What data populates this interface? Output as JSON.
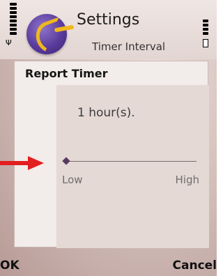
{
  "header": {
    "title": "Settings",
    "subtitle": "Timer Interval",
    "app_icon": "app-logo-icon"
  },
  "status": {
    "signal_icon": "signal-strength-icon",
    "battery_icon": "battery-icon"
  },
  "panel": {
    "title": "Report Timer",
    "value": "1 hour(s).",
    "slider": {
      "position": 0.0,
      "min_label": "Low",
      "max_label": "High"
    }
  },
  "softkeys": {
    "left": "OK",
    "right": "Cancel"
  },
  "annotation": {
    "arrow_icon": "red-arrow-icon",
    "color": "#e21e1e"
  }
}
